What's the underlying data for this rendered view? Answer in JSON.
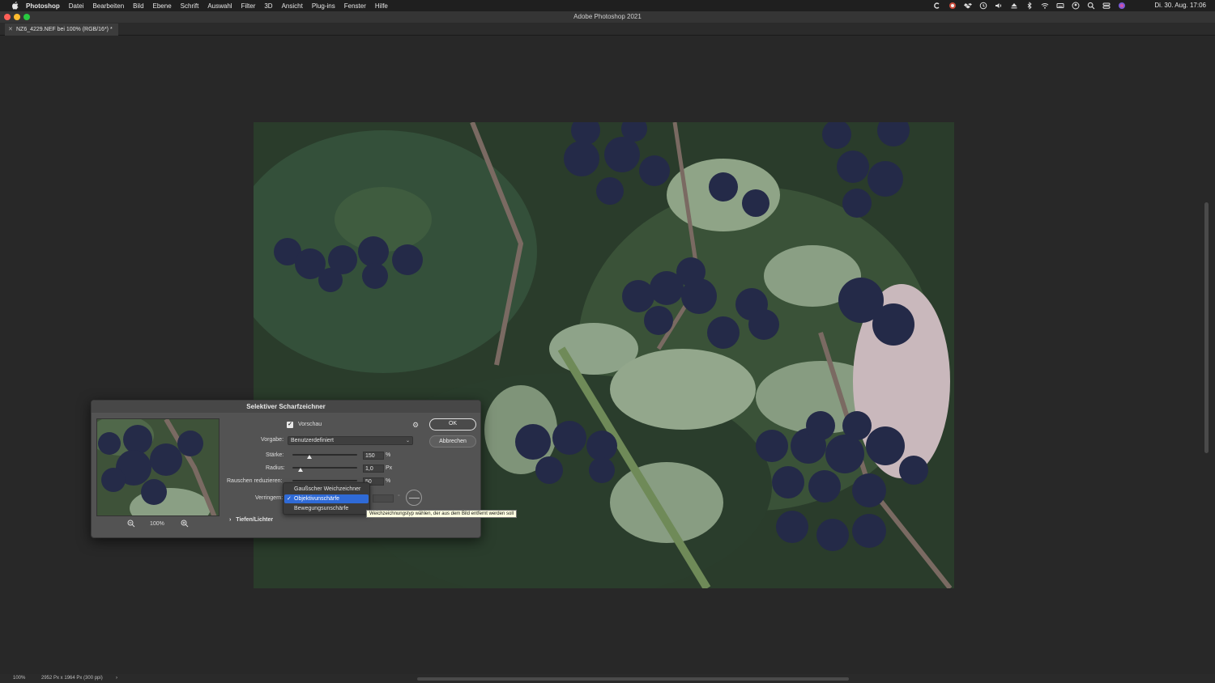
{
  "menubar": {
    "app": "Photoshop",
    "items": [
      "Datei",
      "Bearbeiten",
      "Bild",
      "Ebene",
      "Schrift",
      "Auswahl",
      "Filter",
      "3D",
      "Ansicht",
      "Plug-ins",
      "Fenster",
      "Hilfe"
    ],
    "clock": "Di. 30. Aug. 17:06"
  },
  "window": {
    "title": "Adobe Photoshop 2021"
  },
  "document": {
    "tab_label": "NZ6_4229.NEF bei 100% (RGB/16*) *"
  },
  "statusbar": {
    "zoom": "100%",
    "info": "2952 Px x 1964 Px (300 ppi)",
    "arrow": "›"
  },
  "dialog": {
    "title": "Selektiver Scharfzeichner",
    "preview_label": "Vorschau",
    "preview_checked": true,
    "zoom": "100%",
    "ok": "OK",
    "cancel": "Abbrechen",
    "preset_label": "Vorgabe:",
    "preset_value": "Benutzerdefiniert",
    "amount_label": "Stärke:",
    "amount_value": "150",
    "amount_unit": "%",
    "radius_label": "Radius:",
    "radius_value": "1,0",
    "radius_unit": "Px",
    "noise_label": "Rauschen reduzieren:",
    "noise_value": "50",
    "noise_unit": "%",
    "remove_label": "Verringern:",
    "degree": "°",
    "shadows_highlights": "Tiefen/Lichter"
  },
  "dropdown": {
    "options": [
      "Gaußscher Weichzeichner",
      "Objektivunschärfe",
      "Bewegungsunschärfe"
    ],
    "selected_index": 1,
    "check": "✓"
  },
  "tooltip": "Weichzeichnungstyp wählen, der aus dem Bild entfernt werden soll",
  "colors": {
    "accent": "#2f6ad6",
    "dialog_bg": "#535353",
    "workspace": "#282828"
  }
}
